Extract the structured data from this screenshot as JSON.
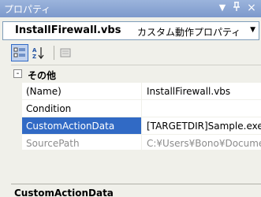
{
  "window": {
    "title": "プロパティ",
    "controls": {
      "dropdown": "▼",
      "pin": "ᛕ",
      "close": "×"
    }
  },
  "object_selector": {
    "name": "InstallFirewall.vbs",
    "type": "カスタム動作プロパティ"
  },
  "toolbar": {
    "buttons": [
      {
        "icon": "categorized-icon",
        "active": true
      },
      {
        "icon": "alphabetical-sort-icon",
        "active": false
      },
      {
        "icon": "property-pages-icon",
        "active": false
      }
    ]
  },
  "grid": {
    "category": {
      "toggle": "-",
      "label": "その他"
    },
    "rows": [
      {
        "name": "(Name)",
        "value": "InstallFirewall.vbs",
        "selected": false,
        "disabled": false
      },
      {
        "name": "Condition",
        "value": "",
        "selected": false,
        "disabled": false
      },
      {
        "name": "CustomActionData",
        "value": "[TARGETDIR]Sample.exe",
        "selected": true,
        "disabled": false
      },
      {
        "name": "SourcePath",
        "value": "C:¥Users¥Bono¥Documents",
        "selected": false,
        "disabled": true
      }
    ]
  },
  "description": {
    "title": "CustomActionData"
  },
  "colors": {
    "title_bar": "#7d99cc",
    "selection": "#316ac5",
    "panel": "#f0f0ea"
  }
}
